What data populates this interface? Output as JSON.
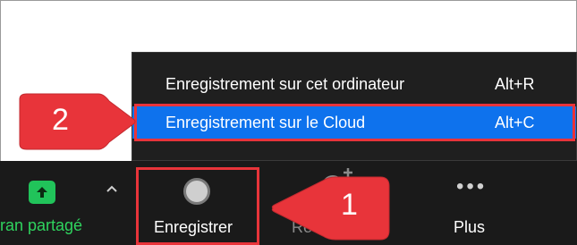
{
  "menu": {
    "items": [
      {
        "label": "Enregistrement sur cet ordinateur",
        "shortcut": "Alt+R"
      },
      {
        "label": "Enregistrement sur le Cloud",
        "shortcut": "Alt+C"
      }
    ],
    "selected_index": 1
  },
  "toolbar": {
    "share_label": "ran partagé",
    "record_label": "Enregistrer",
    "reactions_label": "Ré",
    "more_label": "Plus"
  },
  "callouts": {
    "first": "1",
    "second": "2"
  },
  "icons": {
    "share": "share-screen-up-arrow-icon",
    "caret": "chevron-up-icon",
    "record": "record-circle-icon",
    "reactions": "reactions-icon",
    "more": "more-dots-icon"
  },
  "colors": {
    "menu_bg": "#1f1f1f",
    "selection": "#0e72ed",
    "annotation": "#e8343a",
    "share_green": "#21c35a",
    "toolbar_bg": "#1a1a1a"
  }
}
